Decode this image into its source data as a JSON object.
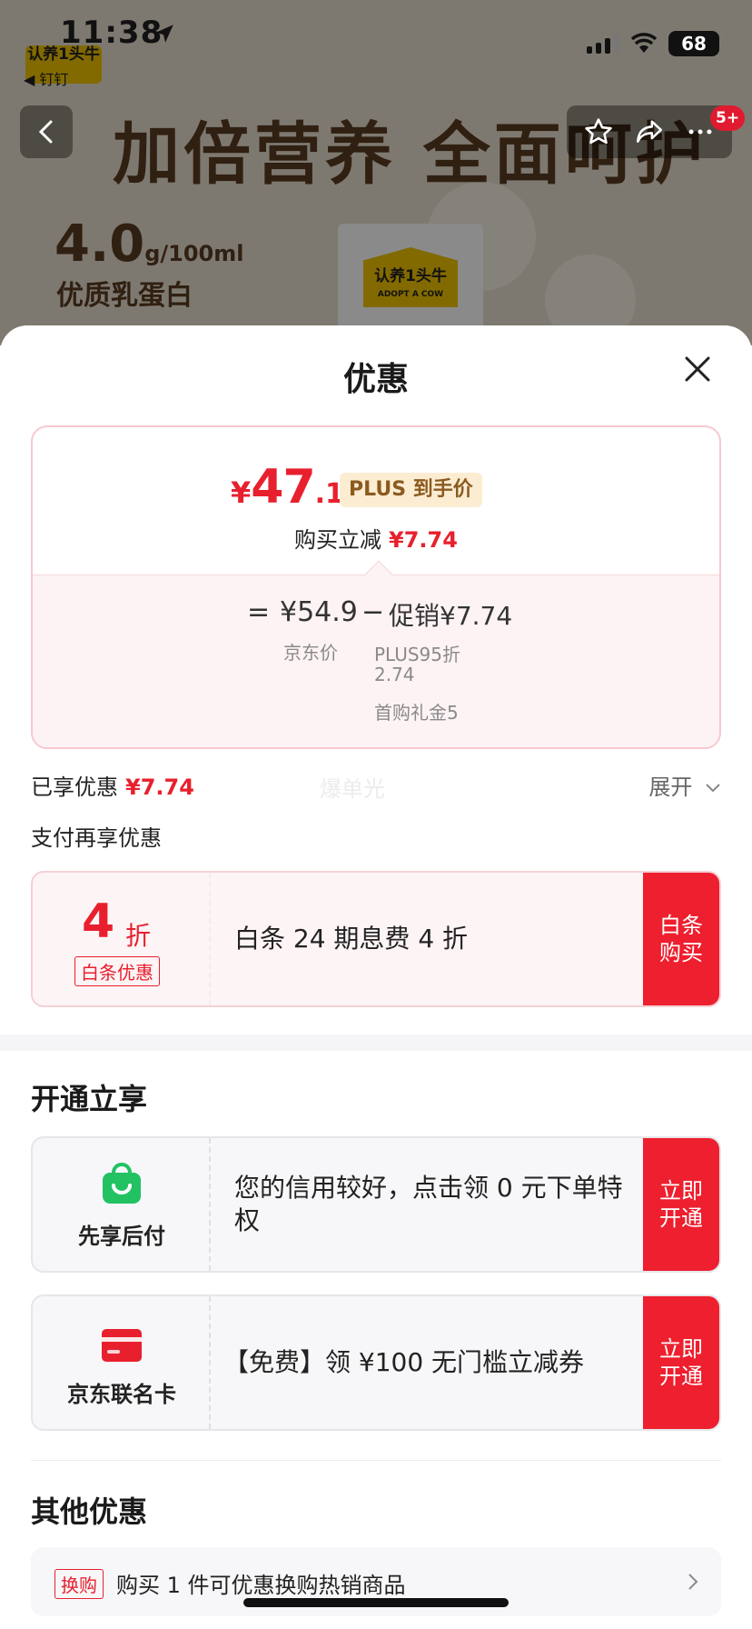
{
  "status_bar": {
    "time": "11:38",
    "battery": "68"
  },
  "background": {
    "brand_logo": "认养1头牛",
    "back_label": "钉钉",
    "headline": "加倍营养 全面呵护",
    "protein_value": "4.0",
    "protein_unit": "g/100ml",
    "protein_label": "优质乳蛋白",
    "box_logo": "认养1头牛",
    "box_logo_sub": "ADOPT A COW",
    "cart_badge": "5+"
  },
  "sheet": {
    "title": "优惠",
    "price_card": {
      "currency": "¥",
      "final_int": "47",
      "final_dec": ".16",
      "plus_tag": "PLUS 到手价",
      "buy_reduce_label": "购买立减",
      "buy_reduce_value": "¥7.74",
      "eq": "=",
      "jd_price": "¥54.9",
      "minus": "−",
      "promo": "促销¥7.74",
      "jd_price_label": "京东价",
      "promo_detail_1": "PLUS95折",
      "promo_detail_1_value": "2.74",
      "promo_detail_2": "首购礼金5"
    },
    "saved_label": "已享优惠",
    "saved_value": "¥7.74",
    "watermark": "爆单光",
    "expand_label": "展开",
    "pay_title": "支付再享优惠",
    "baitiao": {
      "discount_num": "4",
      "discount_unit": "折",
      "tag": "白条优惠",
      "text": "白条 24 期息费 4 折",
      "cta": "白条购买"
    },
    "open_section_title": "开通立享",
    "xianxiang": {
      "label": "先享后付",
      "text": "您的信用较好，点击领 0 元下单特权",
      "cta": "立即开通"
    },
    "jd_card": {
      "label": "京东联名卡",
      "text": "【免费】领 ¥100 无门槛立减券",
      "cta": "立即开通"
    },
    "other_section_title": "其他优惠",
    "other": {
      "tag": "换购",
      "text": "购买 1 件可优惠换购热销商品"
    }
  },
  "colors": {
    "accent": "#e8202e",
    "cta": "#ee1f2e",
    "plus_gold": "#8a5a1f",
    "green": "#22c263"
  }
}
